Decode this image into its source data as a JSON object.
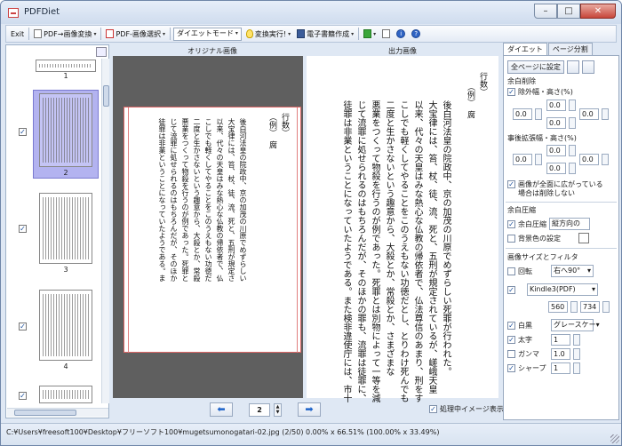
{
  "window": {
    "title": "PDFDiet"
  },
  "toolbar": {
    "exit": "Exit",
    "pdf_to_image": "PDF→画像変換",
    "pdf_image_select": "PDF-画像選択",
    "mode": "ダイエットモード",
    "run": "変換実行!",
    "ebook": "電子書籍作成"
  },
  "thumbnails": {
    "pages": [
      {
        "num": "1",
        "checked": false
      },
      {
        "num": "2",
        "checked": true,
        "selected": true
      },
      {
        "num": "3",
        "checked": true
      },
      {
        "num": "4",
        "checked": true
      }
    ]
  },
  "original": {
    "label": "オリジナル画像",
    "header": "行数）",
    "subheader": "（例）　腐",
    "columns": [
      "後白河法皇の院政中、京の加茂の川原でめずらしい",
      "大宝律には、笞、杖、徒、流、死と、五刑が規定さ",
      "以来、代々の天皇はみな熱心な仏教の帰依者で、仏",
      "こしでも軽くしてやることをこのうえもない功徳だ",
      "二度と生かさないという趣意から、大殺とか、常殺",
      "悪業をつくって物殺を行うのが例であった。死罪と",
      "じて流罪に処せられるのはもちろんだが、そのほか",
      "徒罪は非業ということになっていたようである。ま"
    ]
  },
  "output": {
    "label": "出力画像",
    "header": "行数）",
    "subheader": "（例）　腐",
    "columns": [
      "後白河法皇の院政中、京の加茂の川原でめずらしい死罪が行われた。",
      "大宝律には、笞、杖、徒、流、死と、五刑が規定されているが、嵯峨天皇",
      "以来、代々の天皇はみな熱心な仏教の帰依者で、仏法尊信のあまり、刑をす",
      "こしでも軽くしてやることをこのうえもない功徳だとし、とりわけ死んでも",
      "二度と生かさないという趣意から、大殺とか、常殺とか、さまざまな",
      "悪業をつくって物殺を行うのが例であった。死罪とは別物によって一等を減",
      "じて流罪に処せられるのはもちろんだが、そのほかの罪も、流罪は徒罪に、",
      "徒罪は非業ということになっていたようである。また検非違使庁には、市十"
    ]
  },
  "nav": {
    "page": "2",
    "process_label": "処理中イメージ表示",
    "process_checked": true
  },
  "side": {
    "tab_diet": "ダイエット",
    "tab_split": "ページ分割",
    "all_pages": "全ページに設定",
    "margin_delete": "余白削除",
    "except_width_height": "除外幅・高さ(%)",
    "margin_vals": {
      "left": "0.0",
      "top": "0.0",
      "bottom": "0.0",
      "right": "0.0"
    },
    "after_expand": "事後拡張幅・高さ(%)",
    "expand_vals": {
      "left": "0.0",
      "top": "0.0",
      "bottom": "0.0",
      "right": "0.0"
    },
    "whole_image_note_1": "画像が全面に広がっている",
    "whole_image_note_2": "場合は削除しない",
    "margin_compress": "余白圧縮",
    "margin_compress_cb": "余白圧縮",
    "compress_dir": "縦方向の",
    "bg_color": "背景色の設定",
    "resize_filter": "画像サイズとフィルタ",
    "rotate": "回転",
    "rotate_dir": "右へ90°",
    "device": "Kindle3(PDF)",
    "width": "560",
    "height": "734",
    "bw": "白黒",
    "grayscale": "グレースケー",
    "bold": "太字",
    "bold_val": "1",
    "gamma": "ガンマ",
    "gamma_val": "1.0",
    "sharp": "シャープ",
    "sharp_val": "1"
  },
  "status": {
    "text": "C:¥Users¥freesoft100¥Desktop¥フリーソフト100¥mugetsumonogatari-02.jpg (2/50)  0.00% x 66.51% (100.00% x 33.49%)"
  }
}
